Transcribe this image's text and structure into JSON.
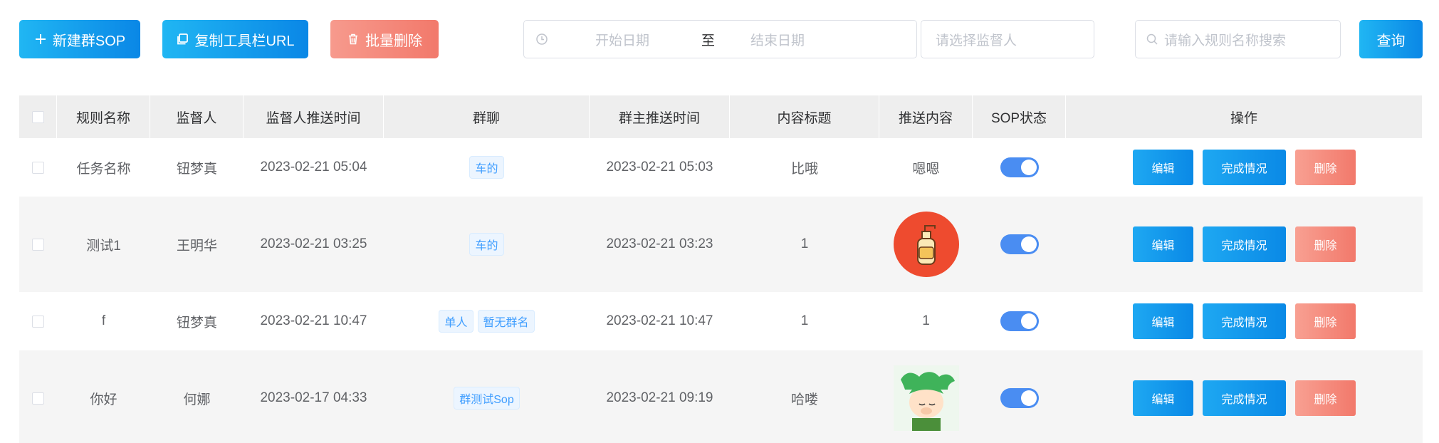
{
  "toolbar": {
    "new_sop": "新建群SOP",
    "copy_url": "复制工具栏URL",
    "batch_delete": "批量删除",
    "date_start_placeholder": "开始日期",
    "date_separator": "至",
    "date_end_placeholder": "结束日期",
    "supervisor_placeholder": "请选择监督人",
    "search_placeholder": "请输入规则名称搜索",
    "query": "查询"
  },
  "table": {
    "headers": [
      "规则名称",
      "监督人",
      "监督人推送时间",
      "群聊",
      "群主推送时间",
      "内容标题",
      "推送内容",
      "SOP状态",
      "操作"
    ],
    "rows": [
      {
        "name": "任务名称",
        "supervisor": "钮梦真",
        "supervisor_time": "2023-02-21 05:04",
        "groups": [
          "车的"
        ],
        "owner_time": "2023-02-21 05:03",
        "title": "比哦",
        "content_text": "嗯嗯",
        "content_image": "",
        "sop_enabled": true
      },
      {
        "name": "测试1",
        "supervisor": "王明华",
        "supervisor_time": "2023-02-21 03:25",
        "groups": [
          "车的"
        ],
        "owner_time": "2023-02-21 03:23",
        "title": "1",
        "content_text": "",
        "content_image": "bottle-image",
        "sop_enabled": true
      },
      {
        "name": "f",
        "supervisor": "钮梦真",
        "supervisor_time": "2023-02-21 10:47",
        "groups": [
          "单人",
          "暂无群名"
        ],
        "owner_time": "2023-02-21 10:47",
        "title": "1",
        "content_text": "1",
        "content_image": "",
        "sop_enabled": true
      },
      {
        "name": "你好",
        "supervisor": "何娜",
        "supervisor_time": "2023-02-17 04:33",
        "groups": [
          "群测试Sop"
        ],
        "owner_time": "2023-02-21 09:19",
        "title": "哈喽",
        "content_text": "",
        "content_image": "cartoon-girl-image",
        "sop_enabled": true
      }
    ],
    "actions": {
      "edit": "编辑",
      "completion": "完成情况",
      "delete": "删除"
    }
  },
  "colors": {
    "primary_gradient_start": "#20b6f3",
    "primary_gradient_end": "#0a87e6",
    "danger_gradient_start": "#f79a8d",
    "danger_gradient_end": "#f2796b",
    "switch_on": "#4a8df2",
    "tag_text": "#409eff",
    "tag_bg": "#ecf5ff",
    "header_bg": "#eeeeee"
  }
}
